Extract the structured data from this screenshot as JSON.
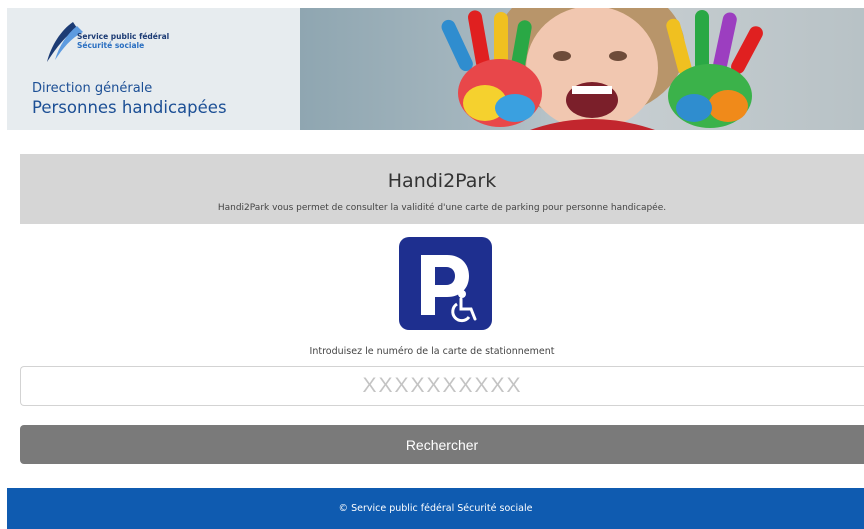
{
  "header": {
    "org_line1": "Service public fédéral",
    "org_line2": "Sécurité sociale",
    "direction_label": "Direction générale",
    "direction_name": "Personnes handicapées"
  },
  "main": {
    "title": "Handi2Park",
    "description": "Handi2Park vous permet de consulter la validité d'une carte de parking pour personne handicapée.",
    "icon": "parking-wheelchair-icon",
    "field_label": "Introduisez le numéro de la carte de stationnement",
    "field_placeholder": "XXXXXXXXXX",
    "field_value": "",
    "search_button": "Rechercher"
  },
  "footer": {
    "text": "© Service public fédéral Sécurité sociale"
  },
  "colors": {
    "brand_blue": "#1c4f95",
    "footer_blue": "#0f5bb0",
    "parking_blue": "#1e2f8f",
    "button_gray": "#7a7a7a",
    "panel_gray": "#d6d6d6"
  }
}
